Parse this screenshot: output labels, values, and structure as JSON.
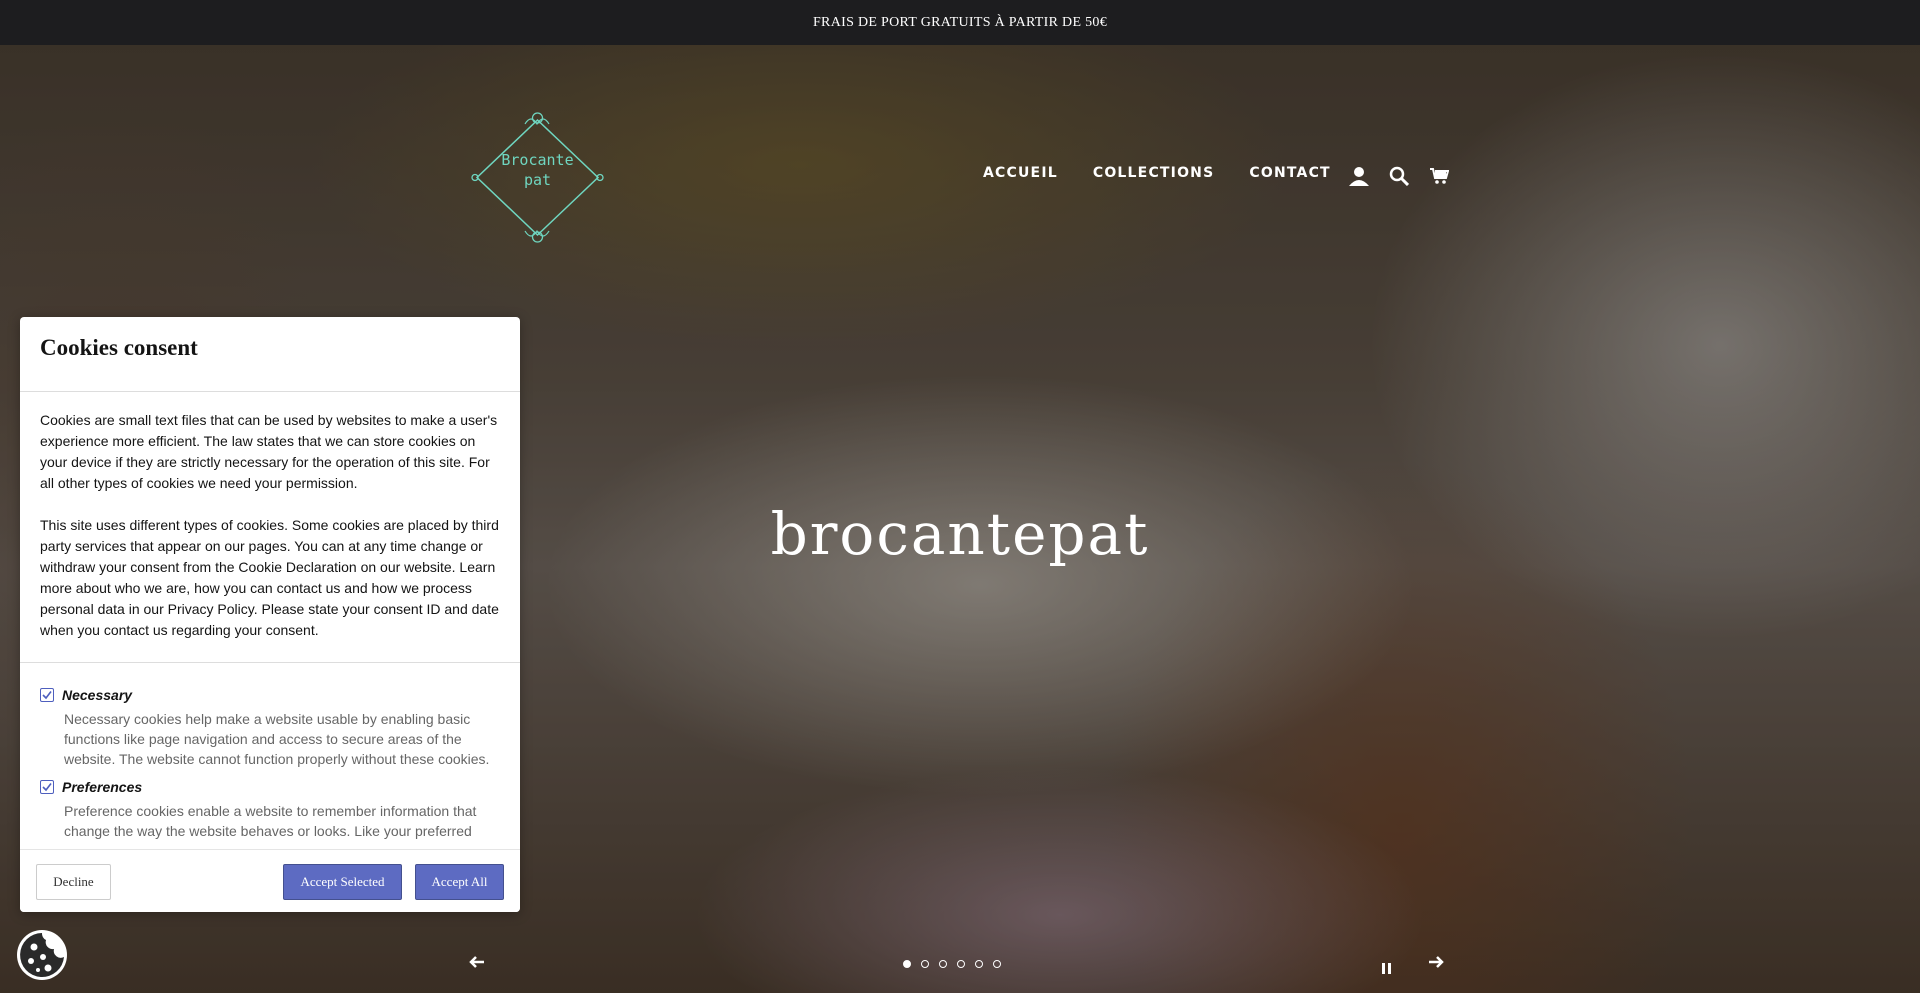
{
  "announcement": "FRAIS DE PORT GRATUITS À PARTIR DE 50€",
  "logo": {
    "line1": "Brocante",
    "line2": "pat"
  },
  "nav": {
    "items": [
      "ACCUEIL",
      "COLLECTIONS",
      "CONTACT"
    ]
  },
  "nav_icons": [
    "account-icon",
    "search-icon",
    "cart-icon"
  ],
  "hero": {
    "title": "brocantepat"
  },
  "slider": {
    "slide_count": 6,
    "active_slide": 1
  },
  "cookie": {
    "title": "Cookies consent",
    "para1": "Cookies are small text files that can be used by websites to make a user's experience more efficient. The law states that we can store cookies on your device if they are strictly necessary for the operation of this site. For all other types of cookies we need your permission.",
    "para2": "This site uses different types of cookies. Some cookies are placed by third party services that appear on our pages. You can at any time change or withdraw your consent from the Cookie Declaration on our website. Learn more about who we are, how you can contact us and how we process personal data in our Privacy Policy. Please state your consent ID and date when you contact us regarding your consent.",
    "options": [
      {
        "name": "Necessary",
        "checked": true,
        "desc": "Necessary cookies help make a website usable by enabling basic functions like page navigation and access to secure areas of the website. The website cannot function properly without these cookies."
      },
      {
        "name": "Preferences",
        "checked": true,
        "desc": "Preference cookies enable a website to remember information that change the way the website behaves or looks. Like your preferred"
      }
    ],
    "decline": "Decline",
    "accept_selected": "Accept Selected",
    "accept_all": "Accept All"
  },
  "colors": {
    "announcement_bg": "#1d1d1f",
    "logo": "#6fd6c0",
    "button": "#5d6bc2"
  }
}
